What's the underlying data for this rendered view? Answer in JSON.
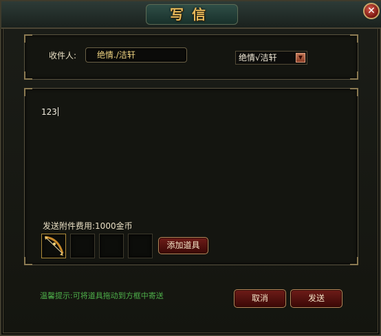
{
  "window": {
    "title": "写信",
    "close_icon": "close-icon"
  },
  "recipient": {
    "label": "收件人:",
    "value": "绝情./洁轩",
    "friend_select_value": "绝情√洁轩",
    "dropdown_icon": "triangle-down-icon"
  },
  "message": {
    "body": "123"
  },
  "attachments": {
    "fee_label": "发送附件费用:1000金币",
    "slots": [
      {
        "icon": "bow-item-icon"
      },
      {
        "icon": "empty-slot"
      },
      {
        "icon": "empty-slot"
      },
      {
        "icon": "empty-slot"
      }
    ],
    "add_button_label": "添加道具"
  },
  "footer": {
    "hint": "温馨提示:可将道具拖动到方框中寄送",
    "cancel_label": "取消",
    "send_label": "发送"
  },
  "colors": {
    "title": "#e6b85a",
    "hint": "#4eb04a",
    "button": "#6e1c18"
  }
}
